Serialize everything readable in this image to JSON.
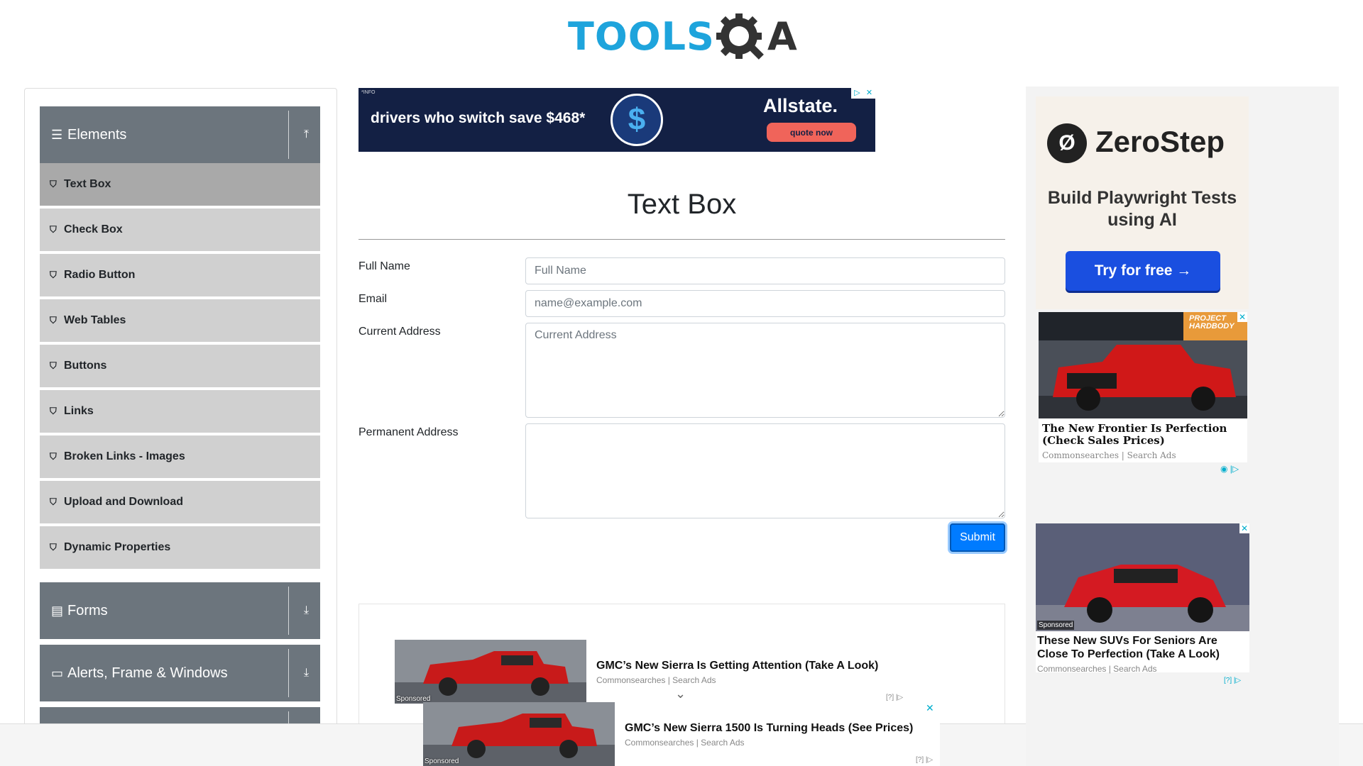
{
  "logo": {
    "text_tools": "TOOLS",
    "text_a": "A"
  },
  "sidebar": {
    "groups": [
      {
        "label": "Elements",
        "icon": "☰",
        "toggle": "⤒"
      },
      {
        "label": "Forms",
        "icon": "▤",
        "toggle": "⤓"
      },
      {
        "label": "Alerts, Frame & Windows",
        "icon": "▭",
        "toggle": "⤓"
      }
    ],
    "items": [
      {
        "label": "Text Box"
      },
      {
        "label": "Check Box"
      },
      {
        "label": "Radio Button"
      },
      {
        "label": "Web Tables"
      },
      {
        "label": "Buttons"
      },
      {
        "label": "Links"
      },
      {
        "label": "Broken Links - Images"
      },
      {
        "label": "Upload and Download"
      },
      {
        "label": "Dynamic Properties"
      }
    ],
    "item_icon": "⛉"
  },
  "top_ad": {
    "info": "*INFO",
    "message": "drivers who switch save $468*",
    "symbol": "$",
    "brand": "Allstate.",
    "cta": "quote now",
    "choice": "▷",
    "close": "✕"
  },
  "main": {
    "title": "Text Box",
    "form": {
      "full_name_label": "Full Name",
      "full_name_placeholder": "Full Name",
      "email_label": "Email",
      "email_placeholder": "name@example.com",
      "current_address_label": "Current Address",
      "current_address_placeholder": "Current Address",
      "permanent_address_label": "Permanent Address",
      "submit_label": "Submit"
    }
  },
  "bottom_ads": [
    {
      "title": "GMC’s New Sierra Is Getting Attention (Take A Look)",
      "source": "Commonsearches | Search Ads",
      "badge": "Sponsored",
      "choice": "[?] |▷"
    },
    {
      "title": "GMC’s New Sierra 1500 Is Turning Heads (See Prices)",
      "source": "Commonsearches | Search Ads",
      "badge": "Sponsored",
      "choice": "[?] |▷",
      "close": "✕"
    }
  ],
  "expand_arrow": "⌄",
  "right_ads": {
    "zerostep": {
      "logo_glyph": "Ø",
      "name": "ZeroStep",
      "tagline": "Build Playwright Tests using AI",
      "cta": "Try for free →"
    },
    "frontier": {
      "title": "The New Frontier Is Perfection (Check Sales Prices)",
      "source": "Commonsearches | Search Ads",
      "badge": "PROJECT HARDBODY",
      "choice": "◉ |▷",
      "close": "✕"
    },
    "suv": {
      "title": "These New SUVs For Seniors Are Close To Perfection (Take A Look)",
      "source": "Commonsearches | Search Ads",
      "badge": "Sponsored",
      "choice": "[?] |▷",
      "close": "✕"
    }
  },
  "colors": {
    "accent": "#1ea4dc",
    "group_bg": "#6c757d",
    "item_bg": "#d0d0d0",
    "active_item": "#a9a9a9",
    "submit": "#007bff"
  }
}
